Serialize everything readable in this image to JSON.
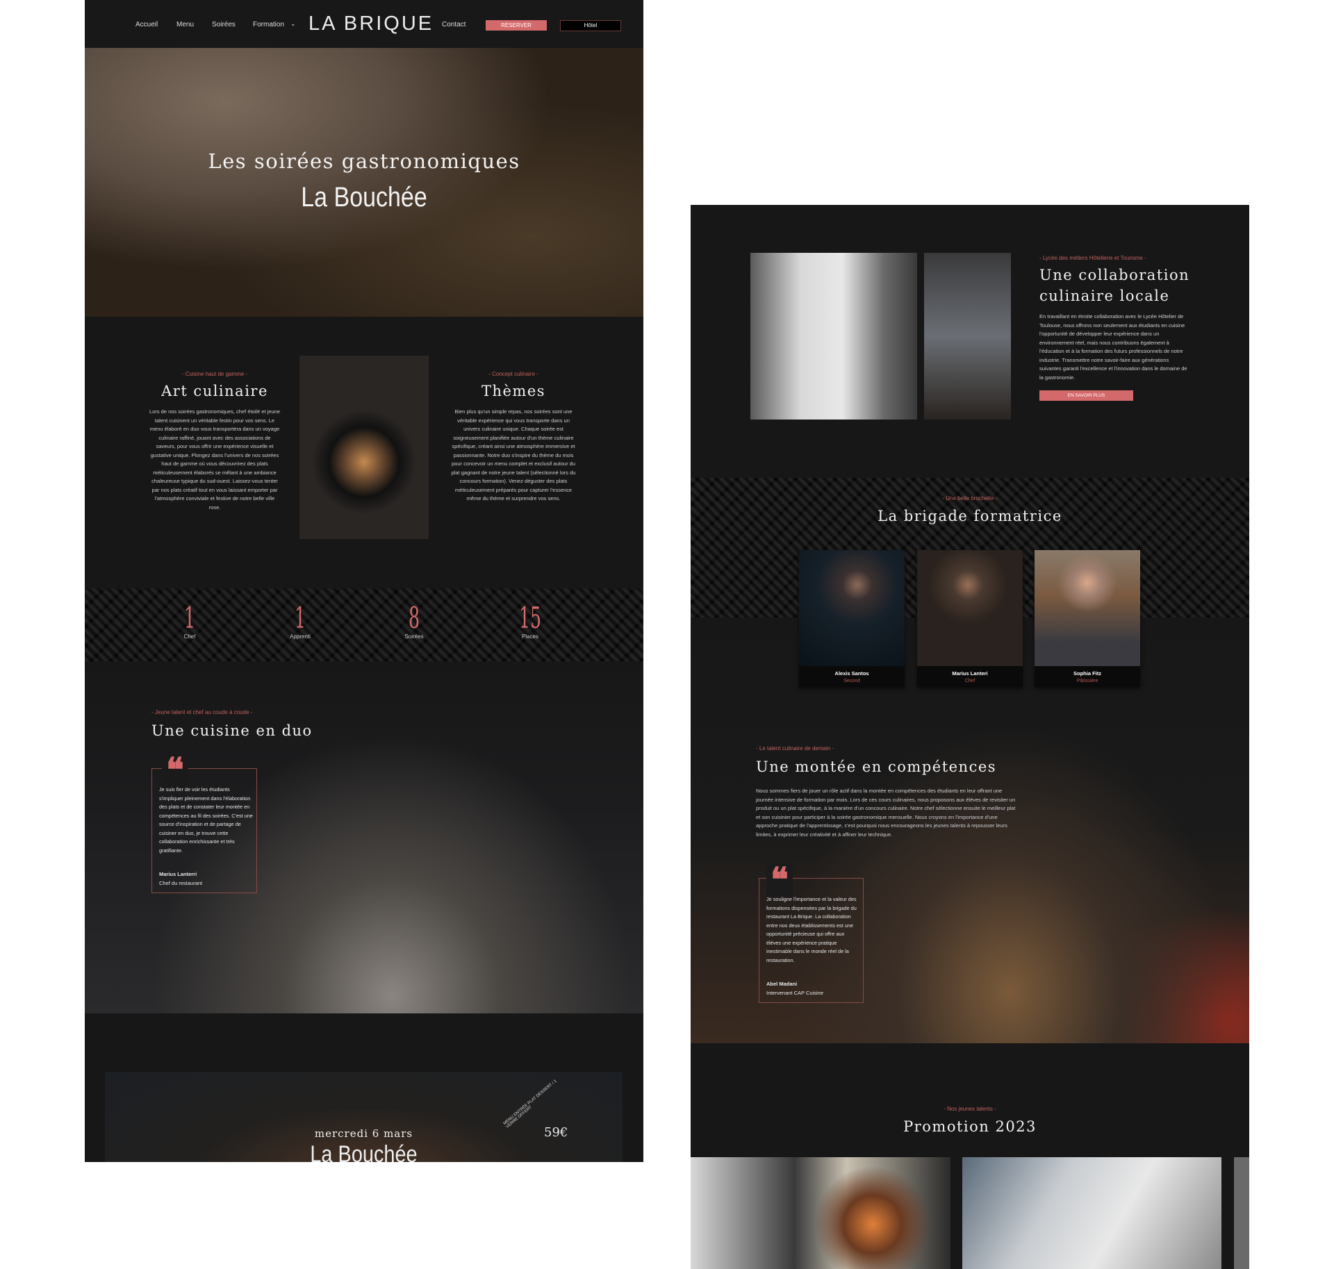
{
  "nav": {
    "items": [
      "Accueil",
      "Menu",
      "Soirées",
      "Formation"
    ],
    "logo": "LA BRIQUE",
    "contact": "Contact",
    "reserve": "RÉSERVER",
    "hotel": "Hôtel",
    "chevron": "chevron-down-icon"
  },
  "hero": {
    "title": "Les soirées gastronomiques",
    "subtitle": "La Bouchée"
  },
  "art": {
    "label": "- Cuisine haut de gamme -",
    "title": "Art culinaire",
    "text": "Lors de nos soirées gastronomiques, chef étoilé et jeune talent cuisinent un véritable festin pour vos sens. Le menu élaboré en duo vous transportera dans un voyage culinaire raffiné, jouant avec des associations de saveurs, pour vous offrir une expérience visuelle et gustative unique. Plongez dans l'univers de nos soirées haut de gamme où vous découvrirez des plats méticuleusement élaborés se mêlant à une ambiance chaleureuse typique du sud-ouest. Laissez-vous tenter par nos plats créatif tout en vous laissant emporter par l'atmosphère conviviale et festive de notre belle ville rose."
  },
  "themes": {
    "label": "- Concept culinaire -",
    "title": "Thèmes",
    "text": "Bien plus qu'un simple repas, nos soirées sont une véritable expérience qui vous transporte dans un univers culinaire unique. Chaque soirée est soigneusement planifiée autour d'un thème culinaire spécifique, créant ainsi une atmosphère immersive et passionnante. Notre duo s'inspire du thème du mois pour concevoir un menu complet et exclusif autour du plat gagnant de notre jeune talent (sélectionné lors du concours formation). Venez déguster des plats méticuleusement préparés pour capturer l'essence même du thème et surprendre vos sens."
  },
  "stats": [
    {
      "value": "1",
      "label": "Chef"
    },
    {
      "value": "1",
      "label": "Apprenti"
    },
    {
      "value": "8",
      "label": "Soirées"
    },
    {
      "value": "15",
      "label": "Places"
    }
  ],
  "duo": {
    "label": "- Jeune talent et chef au coude à coude -",
    "title": "Une cuisine en duo",
    "quote": "Je suis fier de voir les étudiants s'impliquer pleinement dans l'élaboration des plats et de constater leur montée en compétences au fil des soirées. C'est une source d'inspiration et de partage de cuisiner en duo, je trouve cette collaboration enrichissante et très gratifiante.",
    "author": "Marius Lanterri",
    "role": "Chef du restaurant"
  },
  "event": {
    "date": "mercredi 6 mars",
    "title": "La Bouchée",
    "badge": "MENU ENTRÉE PLAT DESSERT / 1 VERRE OFFERT",
    "price": "59€"
  },
  "collab": {
    "label": "- Lycée des métiers Hôtellerie et Tourisme -",
    "title_1": "Une collaboration",
    "title_2": "culinaire locale",
    "text": "En travaillant en étroite collaboration avec le Lycée Hôtelier de Toulouse, nous offrons non seulement aux étudiants en cuisine l'opportunité de développer leur expérience dans un environnement réel, mais nous contribuons également à l'éducation et à la formation des futurs professionnels de notre industrie. Transmettre notre savoir-faire aux générations suivantes garanti l'excellence et l'innovation dans le domaine de la gastronomie.",
    "button": "EN SAVOIR PLUS"
  },
  "brigade": {
    "label": "- Une belle brochette -",
    "title": "La brigade formatrice",
    "members": [
      {
        "name": "Alexis Santos",
        "role": "Second"
      },
      {
        "name": "Marius Lanteri",
        "role": "Chef"
      },
      {
        "name": "Sophia Fitz",
        "role": "Pâtissière"
      }
    ]
  },
  "montee": {
    "label": "- Le talent culinaire de demain -",
    "title": "Une montée en compétences",
    "text": "Nous sommes fiers de jouer un rôle actif dans la montée en compétences des étudiants en leur offrant une journée intensive de formation par mois. Lors de ces cours culinaires, nous proposons aux élèves de revisiter un produit ou un plat spécifique, à la manière d'un concours culinaire. Notre chef sélectionne ensuite le meilleur plat et son cuisinier pour participer à la soirée gastronomique mensuelle. Nous croyons en l'importance d'une approche pratique de l'apprentissage, c'est pourquoi nous encourageons les jeunes talents à repousser leurs limites, à exprimer leur créativité et à affiner leur technique.",
    "quote": "Je souligne l'importance et la valeur des formations dispensées par la brigade du restaurant La Brique. La collaboration entre nos deux établissements est une opportunité précieuse qui offre aux élèves une expérience pratique inestimable dans le monde réel de la restauration.",
    "author": "Abel Madani",
    "role": "Intervenant CAP Cuisine"
  },
  "promo": {
    "label": "- Nos jeunes talents -",
    "title": "Promotion 2023"
  },
  "colors": {
    "accent": "#d4696b",
    "background": "#171717",
    "label": "#c2625d"
  }
}
